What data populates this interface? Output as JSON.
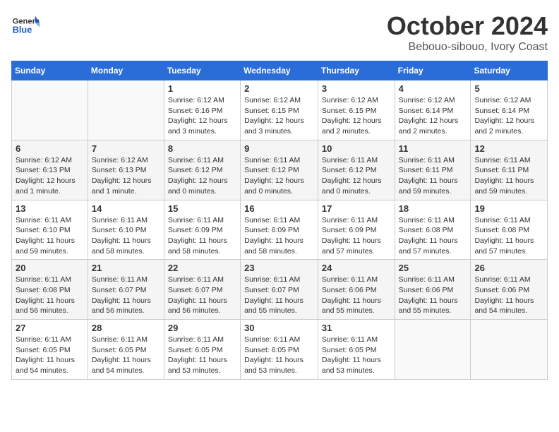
{
  "header": {
    "logo_general": "General",
    "logo_blue": "Blue",
    "title": "October 2024",
    "subtitle": "Bebouo-sibouo, Ivory Coast"
  },
  "days_of_week": [
    "Sunday",
    "Monday",
    "Tuesday",
    "Wednesday",
    "Thursday",
    "Friday",
    "Saturday"
  ],
  "weeks": [
    [
      {
        "day": "",
        "info": ""
      },
      {
        "day": "",
        "info": ""
      },
      {
        "day": "1",
        "info": "Sunrise: 6:12 AM\nSunset: 6:16 PM\nDaylight: 12 hours and 3 minutes."
      },
      {
        "day": "2",
        "info": "Sunrise: 6:12 AM\nSunset: 6:15 PM\nDaylight: 12 hours and 3 minutes."
      },
      {
        "day": "3",
        "info": "Sunrise: 6:12 AM\nSunset: 6:15 PM\nDaylight: 12 hours and 2 minutes."
      },
      {
        "day": "4",
        "info": "Sunrise: 6:12 AM\nSunset: 6:14 PM\nDaylight: 12 hours and 2 minutes."
      },
      {
        "day": "5",
        "info": "Sunrise: 6:12 AM\nSunset: 6:14 PM\nDaylight: 12 hours and 2 minutes."
      }
    ],
    [
      {
        "day": "6",
        "info": "Sunrise: 6:12 AM\nSunset: 6:13 PM\nDaylight: 12 hours and 1 minute."
      },
      {
        "day": "7",
        "info": "Sunrise: 6:12 AM\nSunset: 6:13 PM\nDaylight: 12 hours and 1 minute."
      },
      {
        "day": "8",
        "info": "Sunrise: 6:11 AM\nSunset: 6:12 PM\nDaylight: 12 hours and 0 minutes."
      },
      {
        "day": "9",
        "info": "Sunrise: 6:11 AM\nSunset: 6:12 PM\nDaylight: 12 hours and 0 minutes."
      },
      {
        "day": "10",
        "info": "Sunrise: 6:11 AM\nSunset: 6:12 PM\nDaylight: 12 hours and 0 minutes."
      },
      {
        "day": "11",
        "info": "Sunrise: 6:11 AM\nSunset: 6:11 PM\nDaylight: 11 hours and 59 minutes."
      },
      {
        "day": "12",
        "info": "Sunrise: 6:11 AM\nSunset: 6:11 PM\nDaylight: 11 hours and 59 minutes."
      }
    ],
    [
      {
        "day": "13",
        "info": "Sunrise: 6:11 AM\nSunset: 6:10 PM\nDaylight: 11 hours and 59 minutes."
      },
      {
        "day": "14",
        "info": "Sunrise: 6:11 AM\nSunset: 6:10 PM\nDaylight: 11 hours and 58 minutes."
      },
      {
        "day": "15",
        "info": "Sunrise: 6:11 AM\nSunset: 6:09 PM\nDaylight: 11 hours and 58 minutes."
      },
      {
        "day": "16",
        "info": "Sunrise: 6:11 AM\nSunset: 6:09 PM\nDaylight: 11 hours and 58 minutes."
      },
      {
        "day": "17",
        "info": "Sunrise: 6:11 AM\nSunset: 6:09 PM\nDaylight: 11 hours and 57 minutes."
      },
      {
        "day": "18",
        "info": "Sunrise: 6:11 AM\nSunset: 6:08 PM\nDaylight: 11 hours and 57 minutes."
      },
      {
        "day": "19",
        "info": "Sunrise: 6:11 AM\nSunset: 6:08 PM\nDaylight: 11 hours and 57 minutes."
      }
    ],
    [
      {
        "day": "20",
        "info": "Sunrise: 6:11 AM\nSunset: 6:08 PM\nDaylight: 11 hours and 56 minutes."
      },
      {
        "day": "21",
        "info": "Sunrise: 6:11 AM\nSunset: 6:07 PM\nDaylight: 11 hours and 56 minutes."
      },
      {
        "day": "22",
        "info": "Sunrise: 6:11 AM\nSunset: 6:07 PM\nDaylight: 11 hours and 56 minutes."
      },
      {
        "day": "23",
        "info": "Sunrise: 6:11 AM\nSunset: 6:07 PM\nDaylight: 11 hours and 55 minutes."
      },
      {
        "day": "24",
        "info": "Sunrise: 6:11 AM\nSunset: 6:06 PM\nDaylight: 11 hours and 55 minutes."
      },
      {
        "day": "25",
        "info": "Sunrise: 6:11 AM\nSunset: 6:06 PM\nDaylight: 11 hours and 55 minutes."
      },
      {
        "day": "26",
        "info": "Sunrise: 6:11 AM\nSunset: 6:06 PM\nDaylight: 11 hours and 54 minutes."
      }
    ],
    [
      {
        "day": "27",
        "info": "Sunrise: 6:11 AM\nSunset: 6:05 PM\nDaylight: 11 hours and 54 minutes."
      },
      {
        "day": "28",
        "info": "Sunrise: 6:11 AM\nSunset: 6:05 PM\nDaylight: 11 hours and 54 minutes."
      },
      {
        "day": "29",
        "info": "Sunrise: 6:11 AM\nSunset: 6:05 PM\nDaylight: 11 hours and 53 minutes."
      },
      {
        "day": "30",
        "info": "Sunrise: 6:11 AM\nSunset: 6:05 PM\nDaylight: 11 hours and 53 minutes."
      },
      {
        "day": "31",
        "info": "Sunrise: 6:11 AM\nSunset: 6:05 PM\nDaylight: 11 hours and 53 minutes."
      },
      {
        "day": "",
        "info": ""
      },
      {
        "day": "",
        "info": ""
      }
    ]
  ]
}
